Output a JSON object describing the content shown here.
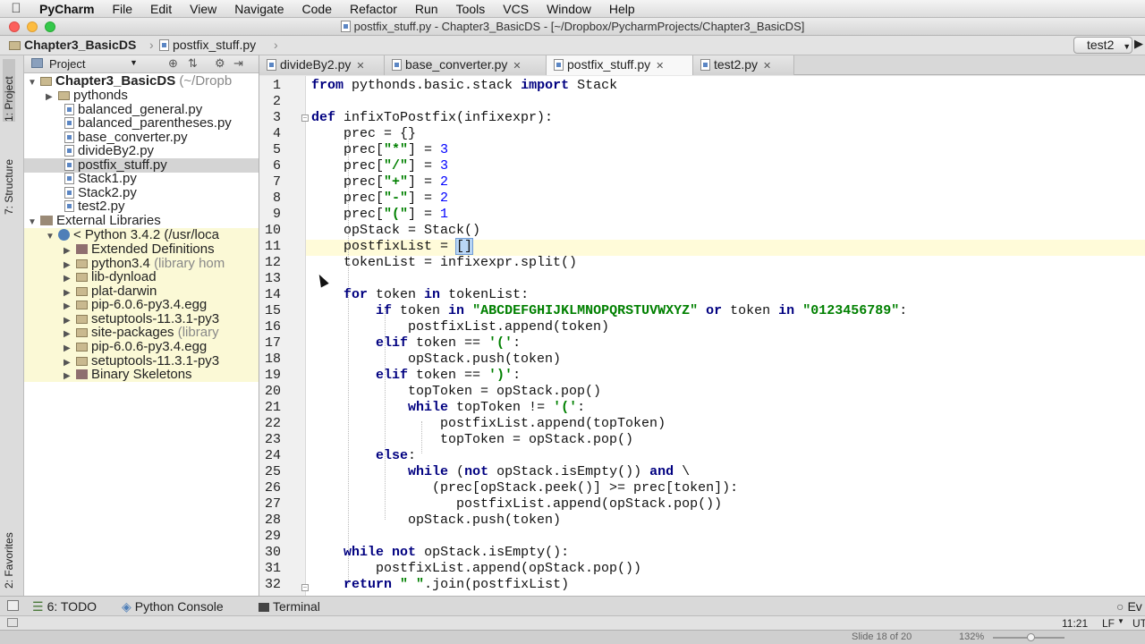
{
  "menubar": {
    "app": "PyCharm",
    "items": [
      "File",
      "Edit",
      "View",
      "Navigate",
      "Code",
      "Refactor",
      "Run",
      "Tools",
      "VCS",
      "Window",
      "Help"
    ]
  },
  "window": {
    "title": "postfix_stuff.py - Chapter3_BasicDS - [~/Dropbox/PycharmProjects/Chapter3_BasicDS]"
  },
  "navbar": {
    "crumb_project": "Chapter3_BasicDS",
    "crumb_file": "postfix_stuff.py",
    "run_config": "test2"
  },
  "leftstrip": {
    "project_tab": "1: Project",
    "structure_tab": "7: Structure",
    "favorites_tab": "2: Favorites"
  },
  "project_panel": {
    "header": "Project",
    "root_name": "Chapter3_BasicDS",
    "root_path": "(~/Dropb",
    "items": [
      {
        "label": "pythonds",
        "kind": "folder"
      },
      {
        "label": "balanced_general.py",
        "kind": "file"
      },
      {
        "label": "balanced_parentheses.py",
        "kind": "file"
      },
      {
        "label": "base_converter.py",
        "kind": "file"
      },
      {
        "label": "divideBy2.py",
        "kind": "file"
      },
      {
        "label": "postfix_stuff.py",
        "kind": "file",
        "selected": true
      },
      {
        "label": "Stack1.py",
        "kind": "file"
      },
      {
        "label": "Stack2.py",
        "kind": "file"
      },
      {
        "label": "test2.py",
        "kind": "file"
      }
    ],
    "external_libraries": "External Libraries",
    "python_sdk": "< Python 3.4.2 (/usr/loca",
    "libs": [
      {
        "label": "Extended Definitions",
        "note": ""
      },
      {
        "label": "python3.4",
        "note": "(library hom"
      },
      {
        "label": "lib-dynload",
        "note": ""
      },
      {
        "label": "plat-darwin",
        "note": ""
      },
      {
        "label": "pip-6.0.6-py3.4.egg",
        "note": ""
      },
      {
        "label": "setuptools-11.3.1-py3",
        "note": ""
      },
      {
        "label": "site-packages",
        "note": "(library"
      },
      {
        "label": "pip-6.0.6-py3.4.egg",
        "note": ""
      },
      {
        "label": "setuptools-11.3.1-py3",
        "note": ""
      },
      {
        "label": "Binary Skeletons",
        "note": ""
      }
    ]
  },
  "tabs": [
    {
      "label": "divideBy2.py",
      "active": false
    },
    {
      "label": "base_converter.py",
      "active": false
    },
    {
      "label": "postfix_stuff.py",
      "active": true
    },
    {
      "label": "test2.py",
      "active": false
    }
  ],
  "editor": {
    "line_numbers": [
      "1",
      "2",
      "3",
      "4",
      "5",
      "6",
      "7",
      "8",
      "9",
      "10",
      "11",
      "12",
      "13",
      "14",
      "15",
      "16",
      "17",
      "18",
      "19",
      "20",
      "21",
      "22",
      "23",
      "24",
      "25",
      "26",
      "27",
      "28",
      "29",
      "30",
      "31",
      "32"
    ],
    "code": [
      "from pythonds.basic.stack import Stack",
      "",
      "def infixToPostfix(infixexpr):",
      "    prec = {}",
      "    prec[\"*\"] = 3",
      "    prec[\"/\"] = 3",
      "    prec[\"+\"] = 2",
      "    prec[\"-\"] = 2",
      "    prec[\"(\"] = 1",
      "    opStack = Stack()",
      "    postfixList = []",
      "    tokenList = infixexpr.split()",
      "",
      "    for token in tokenList:",
      "        if token in \"ABCDEFGHIJKLMNOPQRSTUVWXYZ\" or token in \"0123456789\":",
      "            postfixList.append(token)",
      "        elif token == '(':",
      "            opStack.push(token)",
      "        elif token == ')':",
      "            topToken = opStack.pop()",
      "            while topToken != '(':",
      "                postfixList.append(topToken)",
      "                topToken = opStack.pop()",
      "        else:",
      "            while (not opStack.isEmpty()) and \\",
      "               (prec[opStack.peek()] >= prec[token]):",
      "                  postfixList.append(opStack.pop())",
      "            opStack.push(token)",
      "",
      "    while not opStack.isEmpty():",
      "        postfixList.append(opStack.pop())",
      "    return \" \".join(postfixList)"
    ],
    "caret_line": 11
  },
  "bottom_tabs": {
    "todo": "6: TODO",
    "console": "Python Console",
    "terminal": "Terminal",
    "event_log": "Ev"
  },
  "status": {
    "position": "11:21",
    "line_sep": "LF",
    "encoding": "UT"
  },
  "bottom_overlay": {
    "slide": "Slide 18 of 20",
    "zoom": "132%"
  },
  "colors": {
    "keyword": "#000080",
    "string": "#008000",
    "number": "#0000ff",
    "caret_line": "#fffbd9",
    "library_highlight": "#fbf9d6",
    "selection": "#d4d4d4"
  }
}
